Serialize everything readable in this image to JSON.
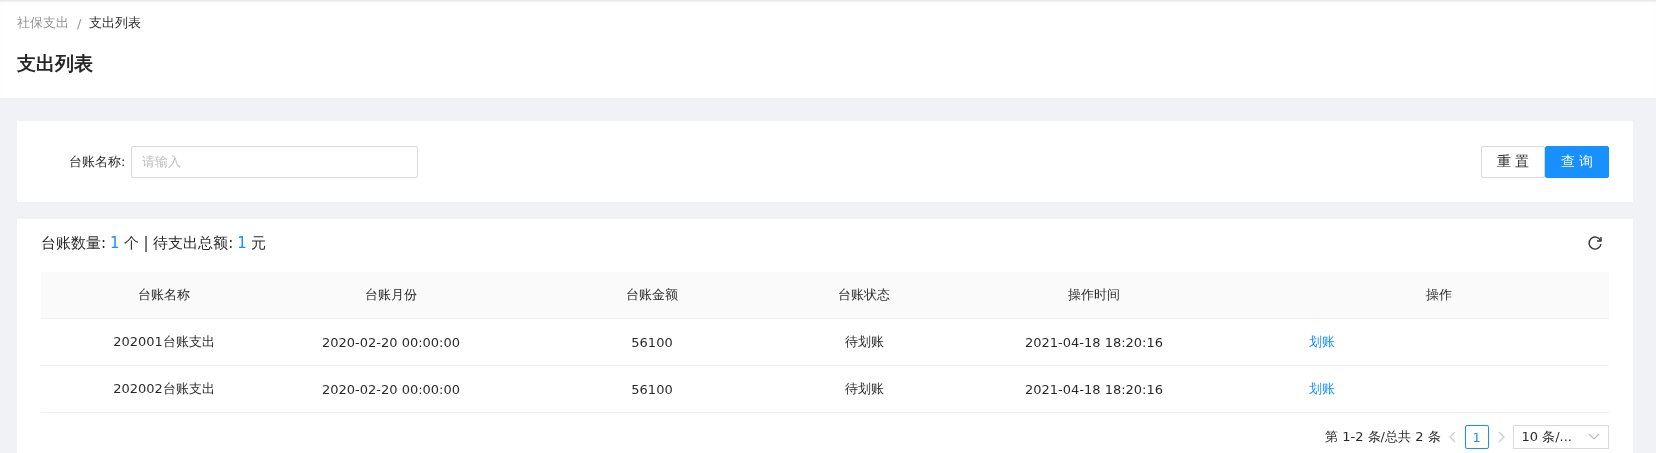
{
  "breadcrumb": [
    {
      "label": "社保支出",
      "current": false
    },
    {
      "label": "支出列表",
      "current": true
    }
  ],
  "breadcrumb_separator": "/",
  "page_title": "支出列表",
  "filter": {
    "label": "台账名称:",
    "placeholder": "请输入",
    "buttons": [
      {
        "label": "重 置",
        "primary": false
      },
      {
        "label": "查 询",
        "primary": true
      }
    ]
  },
  "summary": [
    {
      "text": "台账数量:",
      "highlight": false
    },
    {
      "text": "1",
      "highlight": true
    },
    {
      "text": "个 | 待支出总额:",
      "highlight": false
    },
    {
      "text": "1",
      "highlight": true
    },
    {
      "text": "元",
      "highlight": false
    }
  ],
  "table": {
    "columns": [
      "台账名称",
      "台账月份",
      "台账金额",
      "台账状态",
      "操作时间",
      "操作"
    ],
    "rows": [
      {
        "cells": [
          "202001台账支出",
          "2020-02-20 00:00:00",
          "56100",
          "待划账",
          "2021-04-18 18:20:16"
        ],
        "action": "划账"
      },
      {
        "cells": [
          "202002台账支出",
          "2020-02-20 00:00:00",
          "56100",
          "待划账",
          "2021-04-18 18:20:16"
        ],
        "action": "划账"
      }
    ]
  },
  "pagination": {
    "summary": "第 1-2 条/总共 2 条",
    "pages": [
      {
        "label": "1",
        "selected": true
      }
    ],
    "page_size": "10 条/..."
  }
}
